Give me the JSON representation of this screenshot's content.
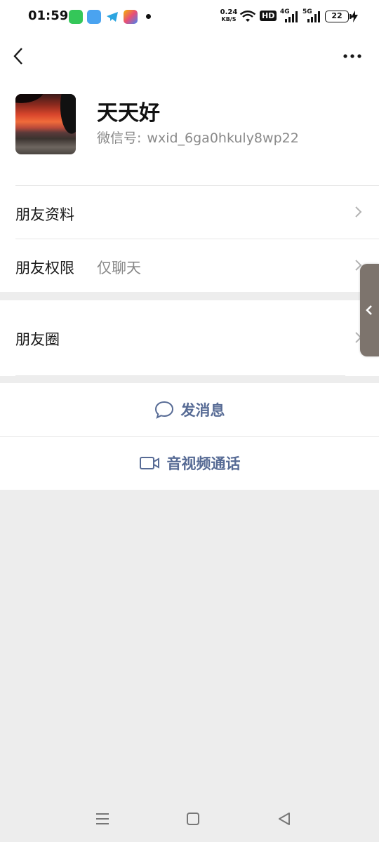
{
  "status_bar": {
    "time": "01:59",
    "net_speed_value": "0.24",
    "net_speed_unit": "KB/S",
    "hd_badge": "HD",
    "signal1_label": "4G",
    "signal2_label": "5G",
    "battery": "22",
    "app_icons": [
      "messages-app-icon",
      "cloud-app-icon",
      "telegram-app-icon",
      "gallery-app-icon"
    ]
  },
  "profile": {
    "nickname": "天天好",
    "wechat_id_label": "微信号:",
    "wechat_id": "wxid_6ga0hkuly8wp22"
  },
  "cells": {
    "friend_info": "朋友资料",
    "friend_permissions": "朋友权限",
    "friend_permissions_value": "仅聊天",
    "moments": "朋友圈"
  },
  "actions": {
    "send_message": "发消息",
    "audio_video_call": "音视频通话"
  },
  "colors": {
    "accent": "#576b95",
    "background": "#ededed"
  }
}
